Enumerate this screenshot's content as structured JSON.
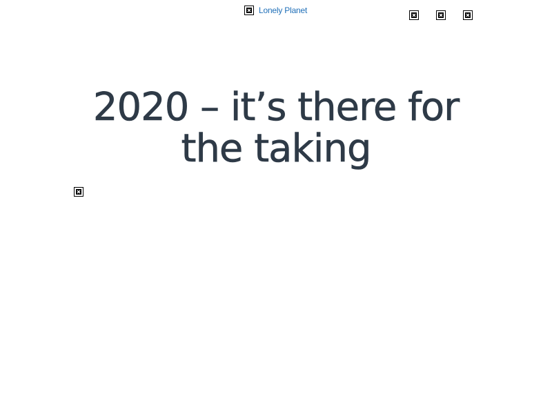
{
  "header": {
    "brand_label": "Lonely Planet",
    "icons": [
      "broken-image-icon",
      "broken-image-icon",
      "broken-image-icon"
    ]
  },
  "hero": {
    "title": "2020 – it’s there for the taking"
  },
  "colors": {
    "link": "#1f6fb8",
    "title": "#2e3a47",
    "background": "#ffffff"
  }
}
